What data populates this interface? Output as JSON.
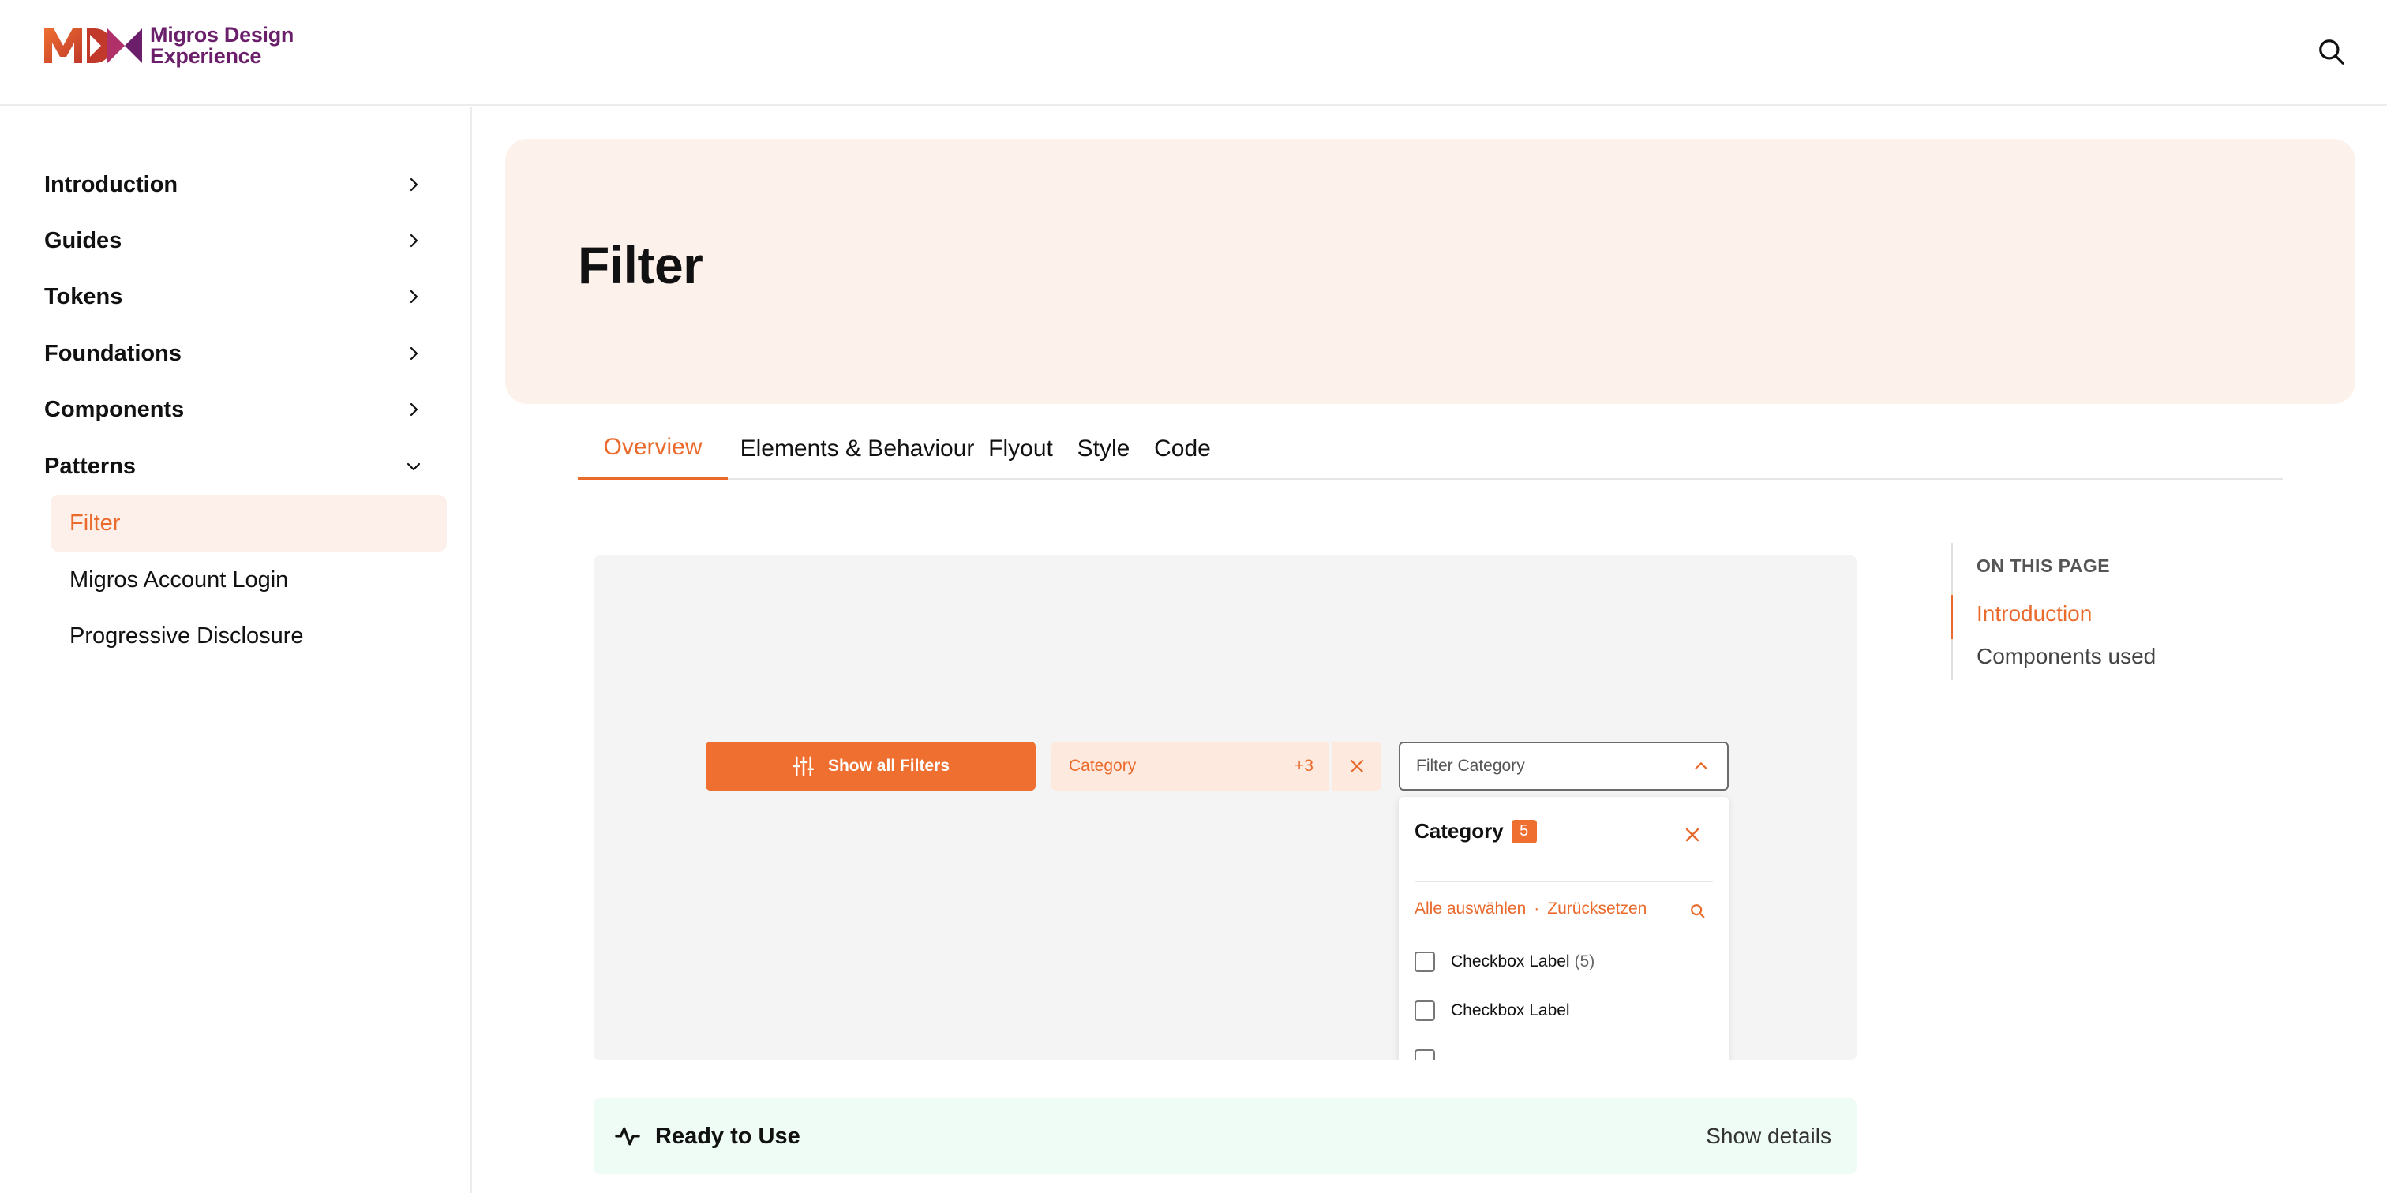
{
  "brand": {
    "name_line1": "Migros Design",
    "name_line2": "Experience",
    "accent": "#EE6F30",
    "brand_purple": "#6B1F6B"
  },
  "header": {
    "search_icon": "search-icon"
  },
  "sidebar": {
    "items": [
      {
        "label": "Introduction",
        "icon": "chevron-right-icon"
      },
      {
        "label": "Guides",
        "icon": "chevron-right-icon"
      },
      {
        "label": "Tokens",
        "icon": "chevron-right-icon"
      },
      {
        "label": "Foundations",
        "icon": "chevron-right-icon"
      },
      {
        "label": "Components",
        "icon": "chevron-right-icon"
      },
      {
        "label": "Patterns",
        "icon": "chevron-down-icon",
        "expanded": true
      }
    ],
    "pattern_children": [
      {
        "label": "Filter",
        "active": true
      },
      {
        "label": "Migros Account Login"
      },
      {
        "label": "Progressive Disclosure"
      }
    ]
  },
  "page": {
    "title": "Filter"
  },
  "tabs": [
    {
      "label": "Overview",
      "active": true
    },
    {
      "label": "Elements & Behaviour"
    },
    {
      "label": "Flyout"
    },
    {
      "label": "Style"
    },
    {
      "label": "Code"
    }
  ],
  "preview": {
    "show_all_label": "Show all Filters",
    "category_chip": {
      "label": "Category",
      "extra": "+3"
    },
    "select_placeholder": "Filter Category",
    "flyout": {
      "title": "Category",
      "badge": "5",
      "select_all": "Alle auswählen",
      "separator": "·",
      "reset": "Zurücksetzen",
      "options": [
        {
          "label": "Checkbox Label",
          "count": "(5)"
        },
        {
          "label": "Checkbox Label",
          "count": ""
        }
      ]
    }
  },
  "status": {
    "title": "Ready to Use",
    "details": "Show details",
    "icon": "activity-icon"
  },
  "toc": {
    "title": "ON THIS PAGE",
    "items": [
      {
        "label": "Introduction",
        "active": true
      },
      {
        "label": "Components used"
      }
    ]
  }
}
